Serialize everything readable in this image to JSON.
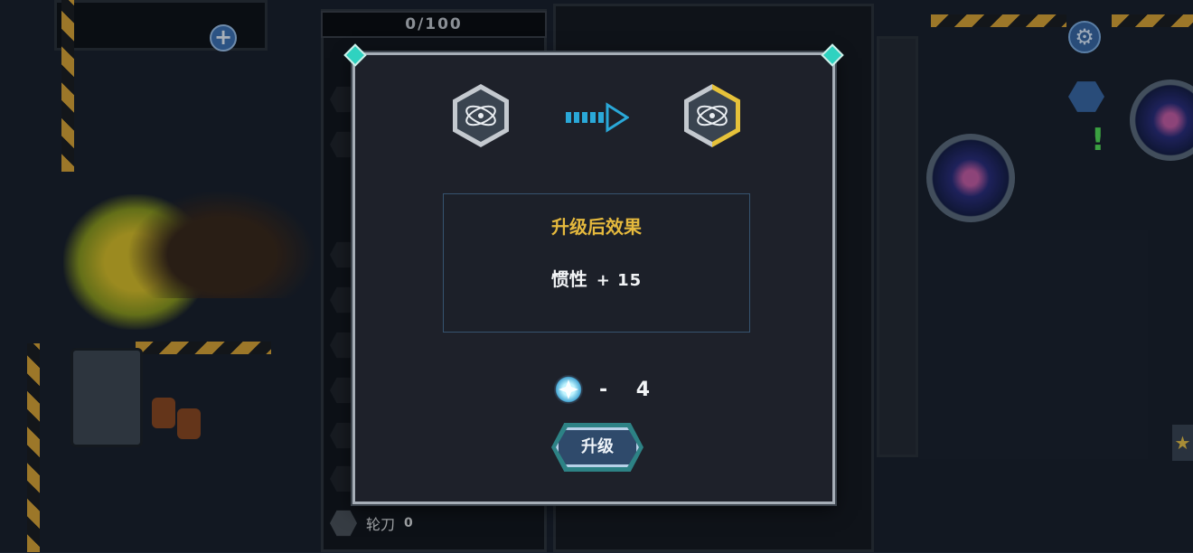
{
  "hud": {
    "capacity": "0/100",
    "plus_icon": "plus-icon",
    "gear_icon": "gear-icon",
    "map_icon": "map-icon",
    "alert_icon": "exclamation-icon"
  },
  "inventory": {
    "blade_item": {
      "label": "轮刀",
      "count": "0"
    }
  },
  "dialog": {
    "effect_title": "升级后效果",
    "stat_name": "惯性",
    "stat_bonus": "+ 15",
    "cost": "- 4",
    "upgrade_button": "升级",
    "skill_icon": "orbit-skill-icon",
    "currency_icon": "crystal-icon"
  },
  "colors": {
    "title_gold": "#e5b93d",
    "accent_cyan": "#3bd4d0",
    "upgraded_gold": "#e6c23a"
  }
}
